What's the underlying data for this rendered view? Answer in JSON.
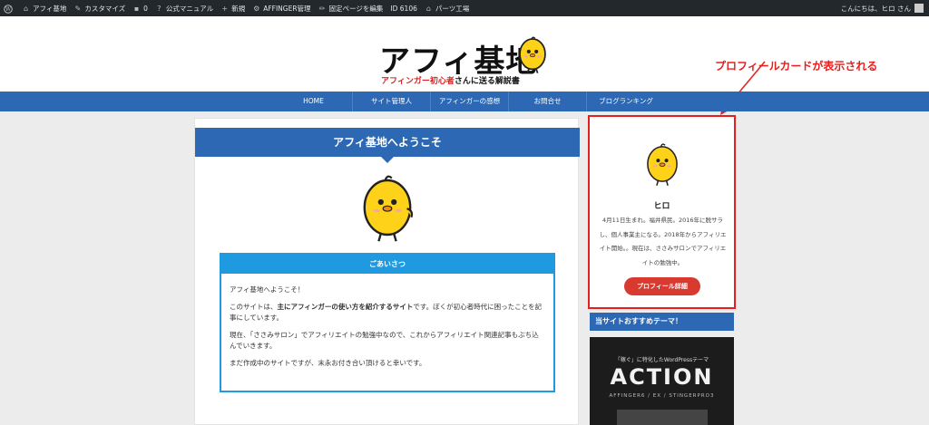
{
  "admin_bar": {
    "items": [
      {
        "icon": "wordpress-icon",
        "label": ""
      },
      {
        "icon": "home-icon",
        "label": "アフィ基地"
      },
      {
        "icon": "brush-icon",
        "label": "カスタマイズ"
      },
      {
        "icon": "comment-icon",
        "label": "0"
      },
      {
        "icon": "help-icon",
        "label": "公式マニュアル"
      },
      {
        "icon": "plus-icon",
        "label": "新規"
      },
      {
        "icon": "gear-icon",
        "label": "AFFINGER管理"
      },
      {
        "icon": "pencil-icon",
        "label": "固定ページを編集"
      },
      {
        "icon": "",
        "label": "ID 6106"
      },
      {
        "icon": "factory-icon",
        "label": "パーツ工場"
      }
    ],
    "greeting": "こんにちは、ヒロ さん"
  },
  "header": {
    "logo_title": "アフィ基地",
    "logo_sub_red": "アフィンガー初心者",
    "logo_sub_rest": "さんに送る解説書"
  },
  "annotation": "プロフィールカードが表示される",
  "nav": {
    "items": [
      {
        "label": "HOME"
      },
      {
        "label": "サイト管理人"
      },
      {
        "label": "アフィンガーの感想"
      },
      {
        "label": "お問合せ"
      },
      {
        "label": "ブログランキング"
      }
    ]
  },
  "main": {
    "title": "アフィ基地へようこそ",
    "greeting_box": {
      "heading": "ごあいさつ",
      "p1": "アフィ基地へようこそ！",
      "p2_a": "このサイトは、",
      "p2_bold": "主にアフィンガーの使い方を紹介するサイト",
      "p2_b": "です。ぼくが初心者時代に困ったことを記事にしています。",
      "p3": "現在、「ささみサロン」でアフィリエイトの勉強中なので、これからアフィリエイト関連記事もぶち込んでいきます。",
      "p4": "まだ作成中のサイトですが、末永お付き合い頂けると幸いです。"
    }
  },
  "sidebar": {
    "profile": {
      "name": "ヒロ",
      "description": "4月11日生まれ。福井県民。2016年に脱サラし、個人事業主になる。2018年からアフィリエイト開始。。現在は、ささみサロンでアフィリエイトの勉強中。",
      "button": "プロフィール詳細"
    },
    "reco_title": "当サイトおすすめテーマ！",
    "banner": {
      "small": "「稼ぐ」に特化したWordPressテーマ",
      "big": "ACTION",
      "sub": "AFFINGER6 / EX / STINGERPRO3"
    }
  },
  "colors": {
    "accent_blue": "#2c68b4",
    "box_blue": "#1f9ae0",
    "annotation_red": "#e61e1e",
    "button_red": "#d93a2f",
    "chick_yellow": "#ffd21a"
  }
}
